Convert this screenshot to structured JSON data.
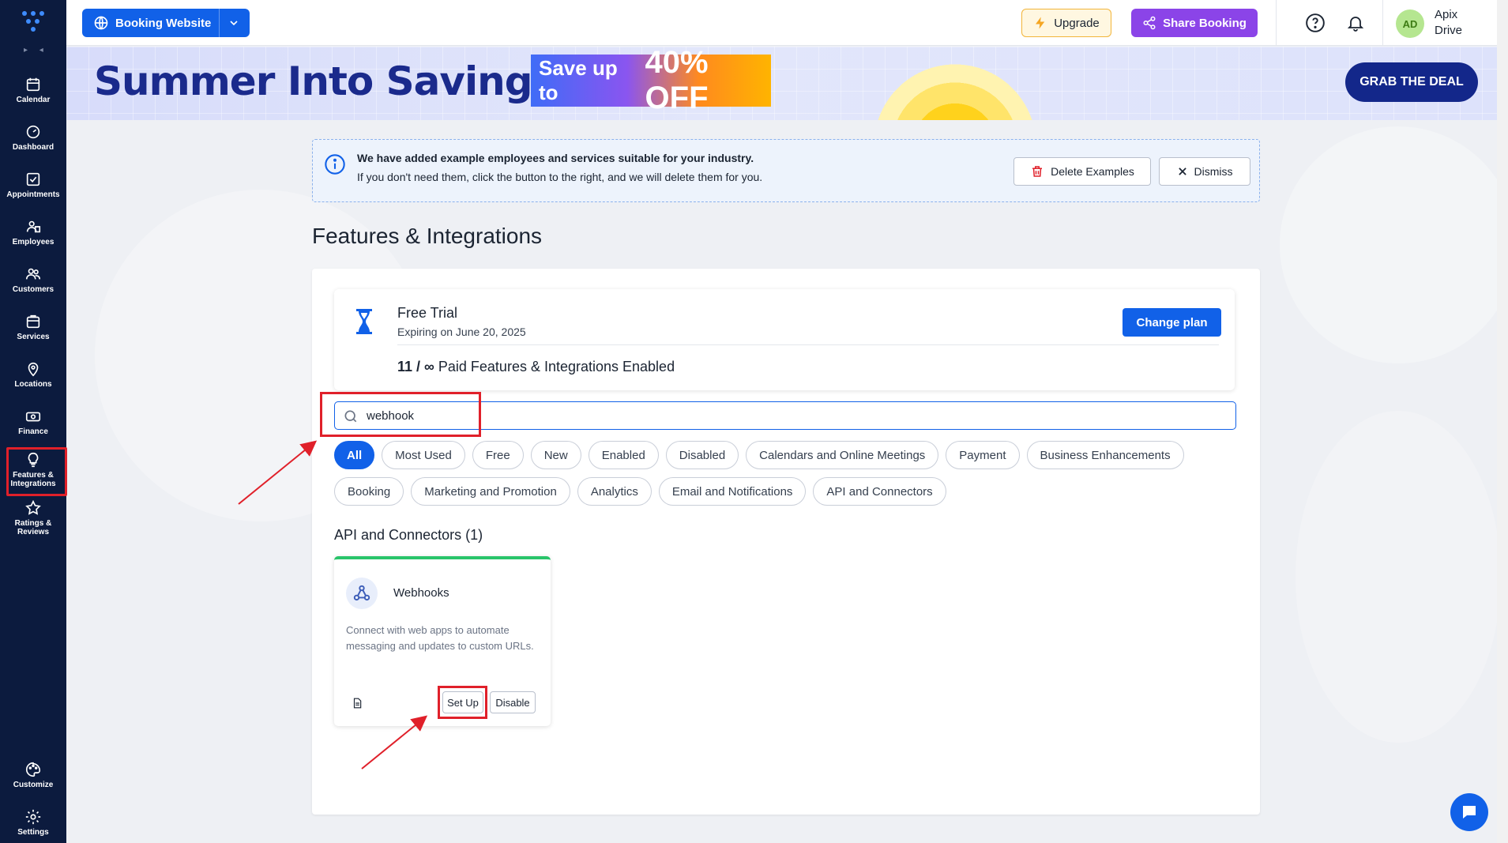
{
  "sidebar": {
    "collapse_glyph": "▸ ◂",
    "items": [
      {
        "label": "Calendar",
        "icon": "calendar-icon"
      },
      {
        "label": "Dashboard",
        "icon": "dashboard-icon"
      },
      {
        "label": "Appointments",
        "icon": "appointments-icon"
      },
      {
        "label": "Employees",
        "icon": "employees-icon"
      },
      {
        "label": "Customers",
        "icon": "customers-icon"
      },
      {
        "label": "Services",
        "icon": "services-icon"
      },
      {
        "label": "Locations",
        "icon": "location-pin-icon"
      },
      {
        "label": "Finance",
        "icon": "finance-icon"
      },
      {
        "label": "Features & Integrations",
        "icon": "lightbulb-icon",
        "active": true
      },
      {
        "label": "Ratings & Reviews",
        "icon": "star-icon"
      },
      {
        "label": "Customize",
        "icon": "palette-icon"
      },
      {
        "label": "Settings",
        "icon": "gear-icon"
      }
    ]
  },
  "topbar": {
    "booking_label": "Booking Website",
    "upgrade_label": "Upgrade",
    "share_label": "Share Booking",
    "avatar_initials": "AD",
    "user_name": "Apix Drive"
  },
  "banner": {
    "title": "Summer Into Savings",
    "save_prefix": "Save up to",
    "save_amount": "40% OFF",
    "cta": "GRAB THE DEAL"
  },
  "notice": {
    "line1": "We have added example employees and services suitable for your industry.",
    "line2": "If you don't need them, click the button to the right, and we will delete them for you.",
    "delete_label": "Delete Examples",
    "dismiss_label": "Dismiss"
  },
  "page": {
    "title": "Features & Integrations"
  },
  "plan": {
    "title": "Free Trial",
    "expiry": "Expiring on June 20, 2025",
    "change_label": "Change plan",
    "count": "11 / ∞",
    "count_suffix": "Paid Features & Integrations Enabled"
  },
  "search": {
    "value": "webhook",
    "placeholder": ""
  },
  "filters": {
    "row1": [
      "All",
      "Most Used",
      "Free",
      "New",
      "Enabled",
      "Disabled",
      "Calendars and Online Meetings",
      "Payment",
      "Business Enhancements"
    ],
    "row2": [
      "Booking",
      "Marketing and Promotion",
      "Analytics",
      "Email and Notifications",
      "API and Connectors"
    ],
    "active": "All"
  },
  "section": {
    "title": "API and Connectors (1)"
  },
  "integration": {
    "name": "Webhooks",
    "description": "Connect with web apps to automate messaging and updates to custom URLs.",
    "setup_label": "Set Up",
    "disable_label": "Disable",
    "status_color": "#29c46a"
  },
  "colors": {
    "primary": "#1161e8",
    "sidebar": "#0c1b3e",
    "share": "#8b44e8",
    "highlight": "#e0202a"
  }
}
